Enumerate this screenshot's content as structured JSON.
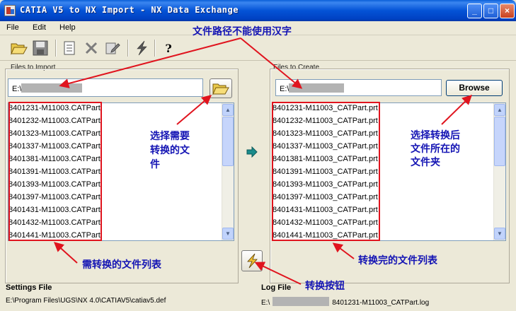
{
  "window": {
    "title": "CATIA V5 to NX Import - NX Data Exchange",
    "controls": {
      "minimize": "_",
      "maximize": "□",
      "close": "×"
    }
  },
  "menu": [
    "File",
    "Edit",
    "Help"
  ],
  "toolbar": {
    "icons": [
      "open-folder-icon",
      "save-disk-icon",
      "properties-icon",
      "delete-x-icon",
      "edit-icon",
      "translate-lightning-icon",
      "help-question-icon"
    ],
    "help_glyph": "?"
  },
  "import_panel": {
    "label": "Files to Import",
    "path_prefix": "E:\\",
    "files": [
      "8401231-M11003.CATPart",
      "8401232-M11003.CATPart",
      "8401323-M11003.CATPart",
      "8401337-M11003.CATPart",
      "8401381-M11003.CATPart",
      "8401391-M11003.CATPart",
      "8401393-M11003.CATPart",
      "8401397-M11003.CATPart",
      "8401431-M11003.CATPart",
      "8401432-M11003.CATPart",
      "8401441-M11003.CATPart"
    ]
  },
  "create_panel": {
    "label": "Files to Create",
    "path_prefix": "E:\\",
    "browse_label": "Browse",
    "files": [
      "8401231-M11003_CATPart.prt",
      "8401232-M11003_CATPart.prt",
      "8401323-M11003_CATPart.prt",
      "8401337-M11003_CATPart.prt",
      "8401381-M11003_CATPart.prt",
      "8401391-M11003_CATPart.prt",
      "8401393-M11003_CATPart.prt",
      "8401397-M11003_CATPart.prt",
      "8401431-M11003_CATPart.prt",
      "8401432-M11003_CATPart.prt",
      "8401441-M11003_CATPart.prt"
    ]
  },
  "status": {
    "settings_label": "Settings File",
    "settings_path": "E:\\Program Files\\UGS\\NX 4.0\\CATIAV5\\catiav5.def",
    "log_label": "Log File",
    "log_prefix": "E:\\",
    "log_suffix": "8401231-M11003_CATPart.log"
  },
  "annotations": {
    "path_note": "文件路径不能使用汉字",
    "select_src_1": "选择需要",
    "select_src_2": "转换的文",
    "select_src_3": "件",
    "select_dst_1": "选择转换后",
    "select_dst_2": "文件所在的",
    "select_dst_3": "文件夹",
    "src_list": "需转换的文件列表",
    "dst_list": "转换完的文件列表",
    "convert": "转换按钮"
  },
  "colors": {
    "annotation_text": "#1414b4",
    "annotation_arrow": "#e0141e",
    "title_bar": "#0453d6"
  }
}
